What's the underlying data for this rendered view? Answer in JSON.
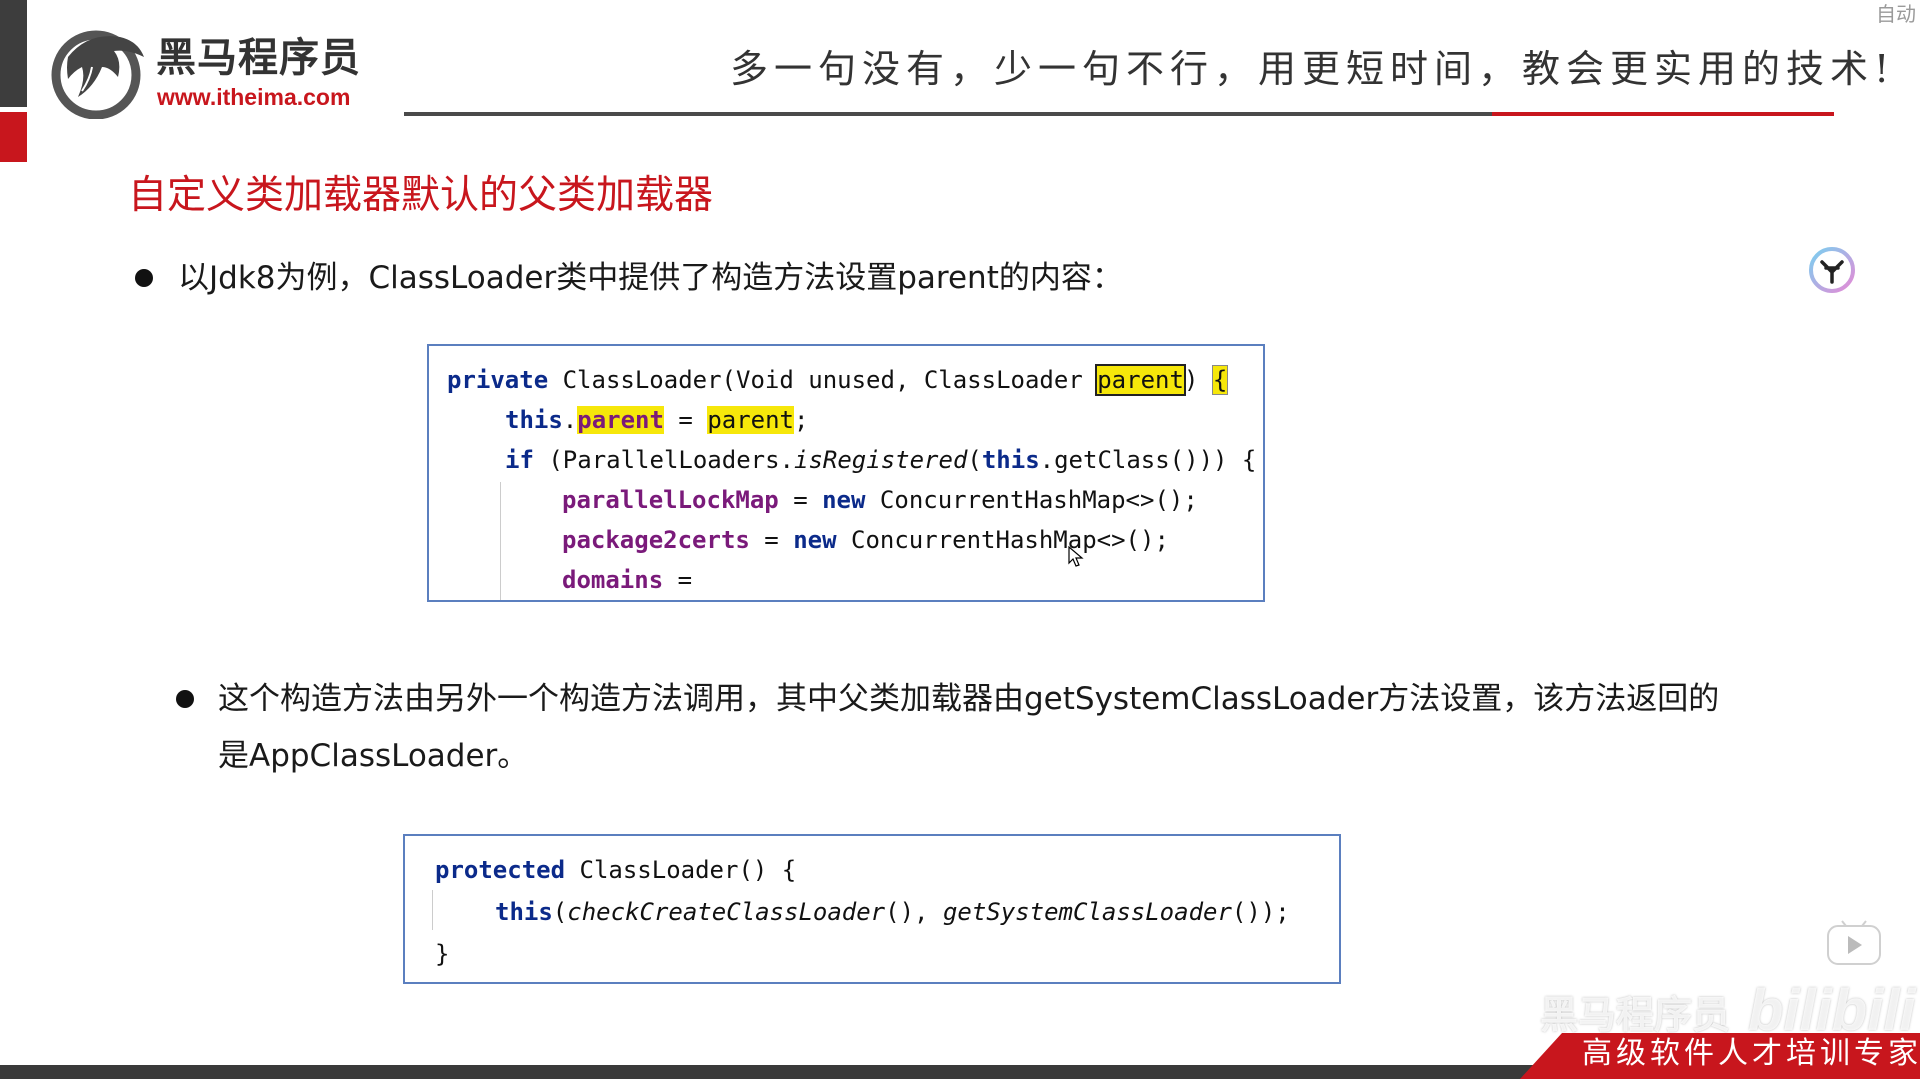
{
  "header": {
    "logo_name": "黑马程序员",
    "logo_url": "www.itheima.com",
    "slogan": "多一句没有，少一句不行，用更短时间，教会更实用的技术!",
    "corner_text": "自动"
  },
  "slide": {
    "title": "自定义类加载器默认的父类加载器",
    "bullet1": "以Jdk8为例，ClassLoader类中提供了构造方法设置parent的内容：",
    "bullet2_line1": "这个构造方法由另外一个构造方法调用，其中父类加载器由getSystemClassLoader方法设置，该方法返回的",
    "bullet2_line2": "是AppClassLoader。"
  },
  "code1": {
    "l1_kw": "private",
    "l1_a": " ClassLoader(Void unused, ClassLoader ",
    "l1_param": "parent",
    "l1_close": ")",
    "l1_brace": "{",
    "l2_this": "this",
    "l2_dot": ".",
    "l2_field": "parent",
    "l2_eq": " = ",
    "l2_param": "parent",
    "l2_semi": ";",
    "l3_kw": "if",
    "l3_a": " (ParallelLoaders.",
    "l3_it": "isRegistered",
    "l3_b": "(",
    "l3_this": "this",
    "l3_c": ".getClass())) {",
    "l4_field": "parallelLockMap",
    "l4_eq": " = ",
    "l4_new": "new",
    "l4_rest": " ConcurrentHashMap<>();",
    "l5_field": "package2certs",
    "l5_eq": " = ",
    "l5_new": "new",
    "l5_rest": " ConcurrentHashMap<>();",
    "l6_field": "domains",
    "l6_eq": " ="
  },
  "code2": {
    "l1_kw": "protected",
    "l1_rest": " ClassLoader() {",
    "l2_this": "this",
    "l2_a": "(",
    "l2_it1": "checkCreateClassLoader",
    "l2_b": "(), ",
    "l2_it2": "getSystemClassLoader",
    "l2_c": "());",
    "l3": "}"
  },
  "watermark": {
    "text1": "黑马程序员",
    "text2": "bilibili"
  },
  "footer": {
    "tagline": "高级软件人才培训专家"
  },
  "colors": {
    "brand_red": "#c8161d",
    "keyword": "#0b2a8a",
    "field": "#7a1a7a",
    "highlight": "#f6e70a",
    "code_border": "#5b7fbf"
  },
  "icons": [
    "horse-logo-icon",
    "bullet-icon",
    "mouse-cursor-icon",
    "assistant-icon",
    "play-icon"
  ]
}
